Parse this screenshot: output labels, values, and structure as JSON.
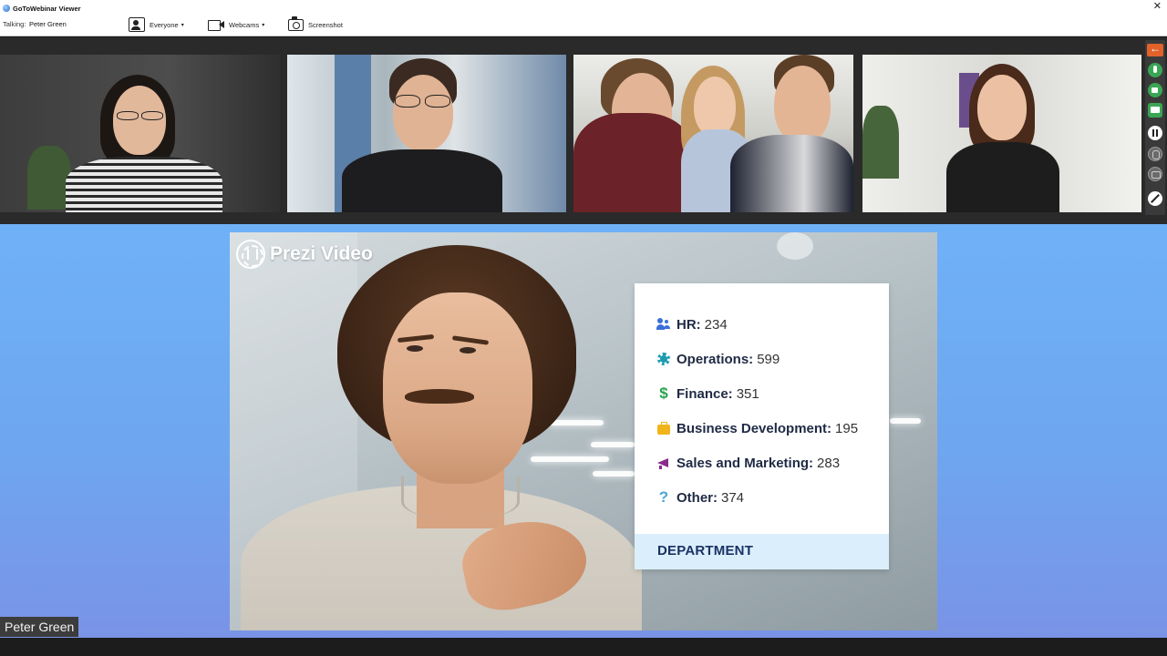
{
  "window": {
    "title": "GoToWebinar Viewer",
    "close_glyph": "✕"
  },
  "header": {
    "talking_label": "Talking:",
    "talking_name": "Peter Green",
    "everyone_label": "Everyone",
    "webcams_label": "Webcams",
    "screenshot_label": "Screenshot",
    "caret": "▾"
  },
  "webcam_thumbnails": [
    {
      "icon": "webcam-thumbnail"
    },
    {
      "icon": "webcam-thumbnail"
    },
    {
      "icon": "webcam-thumbnail"
    },
    {
      "icon": "webcam-thumbnail"
    }
  ],
  "side_toolbar": {
    "items": [
      "back-arrow-icon",
      "microphone-icon",
      "webcam-icon",
      "screen-share-icon",
      "pause-icon",
      "raise-hand-icon",
      "chat-icon",
      "pen-icon"
    ],
    "colors": {
      "back": "#e2622a",
      "active": "#3aa655"
    }
  },
  "presentation": {
    "brand": "Prezi Video",
    "card": {
      "items": [
        {
          "icon": "people-icon",
          "name": "HR:",
          "value": "234"
        },
        {
          "icon": "gear-icon",
          "name": "Operations:",
          "value": "599"
        },
        {
          "icon": "dollar-icon",
          "name": "Finance:",
          "value": "351"
        },
        {
          "icon": "briefcase-icon",
          "name": "Business Development:",
          "value": "195"
        },
        {
          "icon": "megaphone-icon",
          "name": "Sales and Marketing:",
          "value": "283"
        },
        {
          "icon": "question-icon",
          "name": "Other:",
          "value": "374"
        }
      ],
      "footer": "DEPARTMENT"
    }
  },
  "speaker_tag": "Peter Green",
  "colors": {
    "stage_top": "#6fb1f7",
    "stage_bottom": "#7a93e6",
    "card_footer": "#dbeefb"
  }
}
